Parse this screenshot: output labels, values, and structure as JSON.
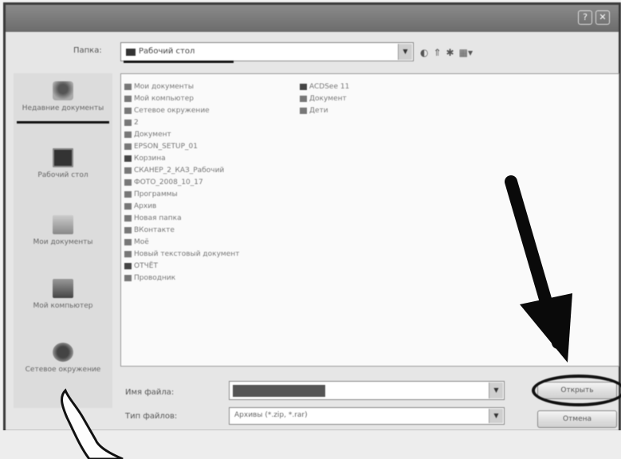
{
  "window": {
    "title": "",
    "help_label": "?",
    "close_label": "✕"
  },
  "lookin": {
    "label": "Папка:",
    "value": "Рабочий стол"
  },
  "toolbar": {
    "icons": [
      "back-icon",
      "up-folder-icon",
      "new-folder-icon",
      "view-menu-icon"
    ]
  },
  "places": [
    {
      "label": "Недавние документы",
      "icon": "recent-documents-icon"
    },
    {
      "label": "Рабочий стол",
      "icon": "desktop-icon"
    },
    {
      "label": "Мои документы",
      "icon": "my-documents-icon"
    },
    {
      "label": "Мой компьютер",
      "icon": "my-computer-icon"
    },
    {
      "label": "Сетевое окружение",
      "icon": "network-icon"
    }
  ],
  "files": {
    "col1": [
      "Мои документы",
      "Мой компьютер",
      "Сетевое окружение",
      "2",
      "Документ",
      "EPSON_SETUP_01",
      "Корзина",
      "СКАНЕР_2_КАЗ_Рабочий",
      "ФОТО_2008_10_17",
      "Программы",
      "Архив",
      "Новая папка",
      "ВКонтакте",
      "Моё",
      "Новый текстовый документ",
      "ОТЧЁТ",
      "Проводник"
    ],
    "col2": [
      "ACDSee 11",
      "Документ",
      "Дети"
    ]
  },
  "filename": {
    "label": "Имя файла:",
    "value": ""
  },
  "filetype": {
    "label": "Тип файлов:",
    "value": "Архивы (*.zip, *.rar)"
  },
  "buttons": {
    "open": "Открыть",
    "cancel": "Отмена"
  }
}
